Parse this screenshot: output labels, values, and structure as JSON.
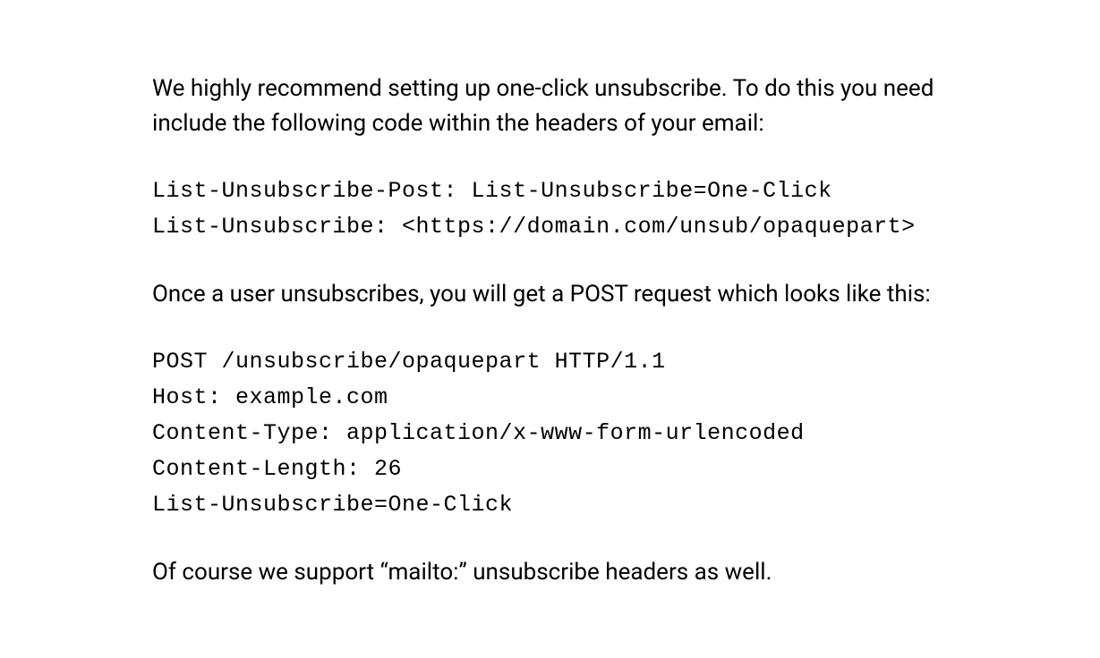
{
  "paragraphs": {
    "intro": "We highly recommend setting up one-click unsubscribe. To do this you need include the following code within the headers of your email:",
    "after_headers": "Once a user unsubscribes, you will get a POST request which looks like this:",
    "closing": "Of course we support “mailto:” unsubscribe headers as well."
  },
  "code": {
    "headers": "List-Unsubscribe-Post: List-Unsubscribe=One-Click\nList-Unsubscribe: <https://domain.com/unsub/opaquepart>",
    "post_request": "POST /unsubscribe/opaquepart HTTP/1.1\nHost: example.com\nContent-Type: application/x-www-form-urlencoded\nContent-Length: 26\nList-Unsubscribe=One-Click"
  }
}
